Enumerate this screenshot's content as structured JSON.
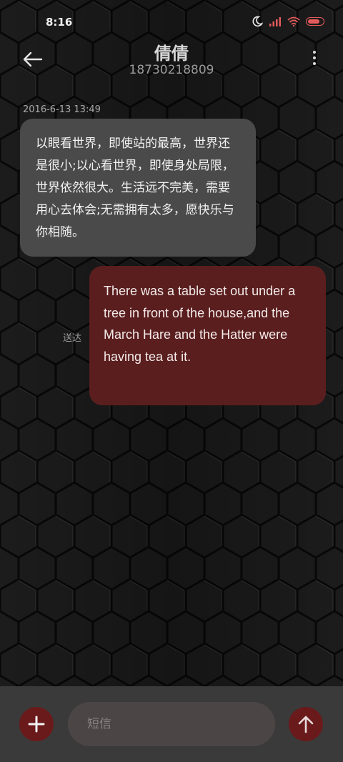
{
  "status_bar": {
    "time": "8:16",
    "icons": [
      "moon-icon",
      "signal-icon",
      "wifi-icon",
      "battery-icon"
    ],
    "battery_level": 0.85,
    "accent_color": "#e35a5a"
  },
  "header": {
    "contact_name": "倩倩",
    "contact_number": "18730218809",
    "back_icon": "back-arrow-icon",
    "more_icon": "more-vertical-icon"
  },
  "conversation": {
    "timestamp": "2016-6-13 13:49",
    "messages": [
      {
        "direction": "incoming",
        "text": "以眼看世界，即使站的最高，世界还是很小;以心看世界，即使身处局限，世界依然很大。生活远不完美，需要用心去体会;无需拥有太多，愿快乐与你相随。",
        "bubble_color": "#4a4a4a"
      },
      {
        "direction": "outgoing",
        "text": "There was a table set out under a tree in front of the house,and the March Hare and the Hatter were having tea at it.",
        "status": "送达",
        "bubble_color": "#5a1e1e"
      }
    ]
  },
  "compose": {
    "add_icon": "plus-icon",
    "placeholder": "短信",
    "value": "",
    "send_icon": "send-arrow-icon",
    "button_color": "#6a1a1a"
  }
}
